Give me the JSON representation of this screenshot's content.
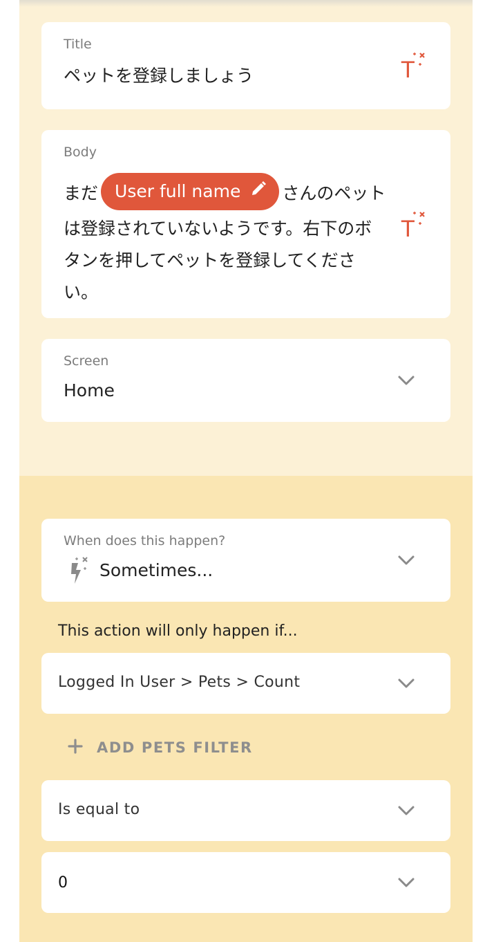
{
  "colors": {
    "accent": "#e0573b",
    "panel_light": "#fcf1d6",
    "panel_dark": "#fae6b3"
  },
  "title_field": {
    "label": "Title",
    "value": "ペットを登録しましょう",
    "icon": "magic-text-icon"
  },
  "body_field": {
    "label": "Body",
    "text_before": "まだ",
    "chip_label": "User full name",
    "chip_icon": "pencil-icon",
    "text_after": "さんのペットは登録されていないようです。右下のボタンを押してペットを登録してください。",
    "icon": "magic-text-icon"
  },
  "screen_field": {
    "label": "Screen",
    "value": "Home",
    "icon": "chevron-down-icon"
  },
  "when_field": {
    "label": "When does this happen?",
    "value": "Sometimes...",
    "icon": "magic-bolt-icon"
  },
  "condition": {
    "info": "This action will only happen if...",
    "source_value": "Logged In User > Pets > Count",
    "add_filter_label": "ADD PETS FILTER",
    "operator_value": "Is equal to",
    "compare_value": "0"
  }
}
